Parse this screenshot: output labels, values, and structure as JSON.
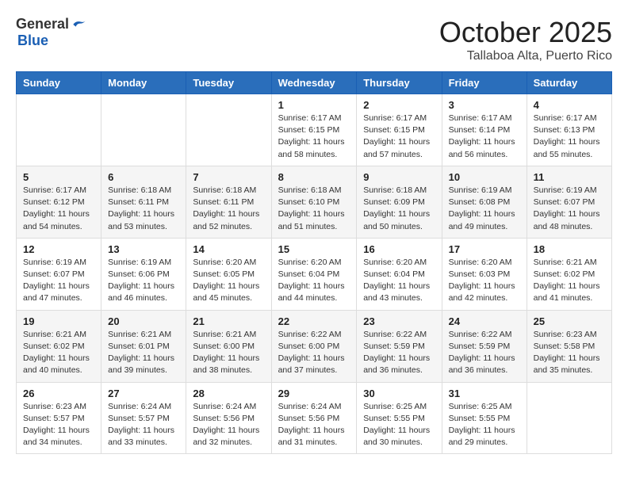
{
  "logo": {
    "general": "General",
    "blue": "Blue"
  },
  "title": "October 2025",
  "subtitle": "Tallaboa Alta, Puerto Rico",
  "weekdays": [
    "Sunday",
    "Monday",
    "Tuesday",
    "Wednesday",
    "Thursday",
    "Friday",
    "Saturday"
  ],
  "weeks": [
    [
      {
        "day": "",
        "info": ""
      },
      {
        "day": "",
        "info": ""
      },
      {
        "day": "",
        "info": ""
      },
      {
        "day": "1",
        "info": "Sunrise: 6:17 AM\nSunset: 6:15 PM\nDaylight: 11 hours and 58 minutes."
      },
      {
        "day": "2",
        "info": "Sunrise: 6:17 AM\nSunset: 6:15 PM\nDaylight: 11 hours and 57 minutes."
      },
      {
        "day": "3",
        "info": "Sunrise: 6:17 AM\nSunset: 6:14 PM\nDaylight: 11 hours and 56 minutes."
      },
      {
        "day": "4",
        "info": "Sunrise: 6:17 AM\nSunset: 6:13 PM\nDaylight: 11 hours and 55 minutes."
      }
    ],
    [
      {
        "day": "5",
        "info": "Sunrise: 6:17 AM\nSunset: 6:12 PM\nDaylight: 11 hours and 54 minutes."
      },
      {
        "day": "6",
        "info": "Sunrise: 6:18 AM\nSunset: 6:11 PM\nDaylight: 11 hours and 53 minutes."
      },
      {
        "day": "7",
        "info": "Sunrise: 6:18 AM\nSunset: 6:11 PM\nDaylight: 11 hours and 52 minutes."
      },
      {
        "day": "8",
        "info": "Sunrise: 6:18 AM\nSunset: 6:10 PM\nDaylight: 11 hours and 51 minutes."
      },
      {
        "day": "9",
        "info": "Sunrise: 6:18 AM\nSunset: 6:09 PM\nDaylight: 11 hours and 50 minutes."
      },
      {
        "day": "10",
        "info": "Sunrise: 6:19 AM\nSunset: 6:08 PM\nDaylight: 11 hours and 49 minutes."
      },
      {
        "day": "11",
        "info": "Sunrise: 6:19 AM\nSunset: 6:07 PM\nDaylight: 11 hours and 48 minutes."
      }
    ],
    [
      {
        "day": "12",
        "info": "Sunrise: 6:19 AM\nSunset: 6:07 PM\nDaylight: 11 hours and 47 minutes."
      },
      {
        "day": "13",
        "info": "Sunrise: 6:19 AM\nSunset: 6:06 PM\nDaylight: 11 hours and 46 minutes."
      },
      {
        "day": "14",
        "info": "Sunrise: 6:20 AM\nSunset: 6:05 PM\nDaylight: 11 hours and 45 minutes."
      },
      {
        "day": "15",
        "info": "Sunrise: 6:20 AM\nSunset: 6:04 PM\nDaylight: 11 hours and 44 minutes."
      },
      {
        "day": "16",
        "info": "Sunrise: 6:20 AM\nSunset: 6:04 PM\nDaylight: 11 hours and 43 minutes."
      },
      {
        "day": "17",
        "info": "Sunrise: 6:20 AM\nSunset: 6:03 PM\nDaylight: 11 hours and 42 minutes."
      },
      {
        "day": "18",
        "info": "Sunrise: 6:21 AM\nSunset: 6:02 PM\nDaylight: 11 hours and 41 minutes."
      }
    ],
    [
      {
        "day": "19",
        "info": "Sunrise: 6:21 AM\nSunset: 6:02 PM\nDaylight: 11 hours and 40 minutes."
      },
      {
        "day": "20",
        "info": "Sunrise: 6:21 AM\nSunset: 6:01 PM\nDaylight: 11 hours and 39 minutes."
      },
      {
        "day": "21",
        "info": "Sunrise: 6:21 AM\nSunset: 6:00 PM\nDaylight: 11 hours and 38 minutes."
      },
      {
        "day": "22",
        "info": "Sunrise: 6:22 AM\nSunset: 6:00 PM\nDaylight: 11 hours and 37 minutes."
      },
      {
        "day": "23",
        "info": "Sunrise: 6:22 AM\nSunset: 5:59 PM\nDaylight: 11 hours and 36 minutes."
      },
      {
        "day": "24",
        "info": "Sunrise: 6:22 AM\nSunset: 5:59 PM\nDaylight: 11 hours and 36 minutes."
      },
      {
        "day": "25",
        "info": "Sunrise: 6:23 AM\nSunset: 5:58 PM\nDaylight: 11 hours and 35 minutes."
      }
    ],
    [
      {
        "day": "26",
        "info": "Sunrise: 6:23 AM\nSunset: 5:57 PM\nDaylight: 11 hours and 34 minutes."
      },
      {
        "day": "27",
        "info": "Sunrise: 6:24 AM\nSunset: 5:57 PM\nDaylight: 11 hours and 33 minutes."
      },
      {
        "day": "28",
        "info": "Sunrise: 6:24 AM\nSunset: 5:56 PM\nDaylight: 11 hours and 32 minutes."
      },
      {
        "day": "29",
        "info": "Sunrise: 6:24 AM\nSunset: 5:56 PM\nDaylight: 11 hours and 31 minutes."
      },
      {
        "day": "30",
        "info": "Sunrise: 6:25 AM\nSunset: 5:55 PM\nDaylight: 11 hours and 30 minutes."
      },
      {
        "day": "31",
        "info": "Sunrise: 6:25 AM\nSunset: 5:55 PM\nDaylight: 11 hours and 29 minutes."
      },
      {
        "day": "",
        "info": ""
      }
    ]
  ]
}
